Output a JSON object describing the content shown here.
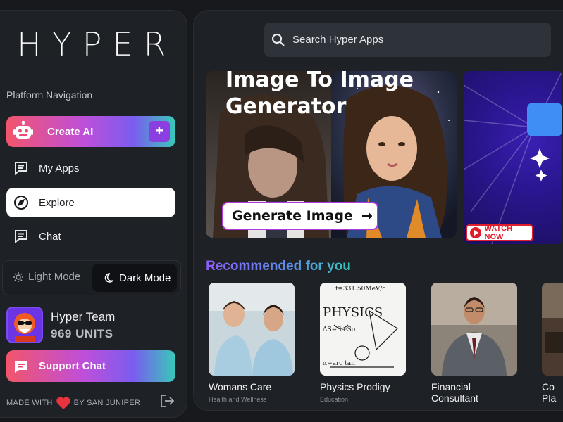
{
  "brand": {
    "logo_text": "HYPER"
  },
  "sidebar": {
    "section_label": "Platform Navigation",
    "create_ai_label": "Create AI",
    "create_ai_plus": "+",
    "items": [
      {
        "label": "My Apps",
        "icon": "apps-chat-icon"
      },
      {
        "label": "Explore",
        "icon": "compass-icon",
        "active": true
      },
      {
        "label": "Chat",
        "icon": "chat-icon"
      }
    ],
    "mode": {
      "light_label": "Light Mode",
      "dark_label": "Dark Mode",
      "selected": "Dark Mode"
    },
    "team": {
      "name": "Hyper Team",
      "units": "969 UNITS"
    },
    "support_label": "Support Chat",
    "footer": {
      "made_with": "MADE WITH",
      "by": "BY SAN JUNIPER"
    }
  },
  "search": {
    "placeholder": "Search Hyper Apps"
  },
  "hero": {
    "title": "Image To Image Generator",
    "button_label": "Generate Image",
    "secondary_badge": "WATCH NOW"
  },
  "recommended": {
    "title": "Recommended for you",
    "cards": [
      {
        "name": "Womans Care",
        "category": "Health and Wellness"
      },
      {
        "name": "Physics Prodigy",
        "category": "Education"
      },
      {
        "name": "Financial Consultant",
        "category": ""
      },
      {
        "name": "Co Pla",
        "category": ""
      }
    ]
  },
  "colors": {
    "accent_gradient": [
      "#f2556c",
      "#c04fd8",
      "#7b5cf0",
      "#38c9b8"
    ],
    "background": "#17191d",
    "panel": "#1e2126"
  }
}
